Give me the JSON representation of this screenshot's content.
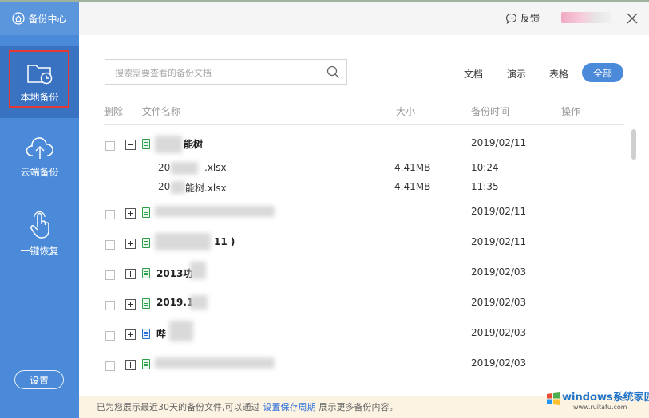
{
  "sidebar": {
    "brand": "备份中心",
    "items": [
      {
        "label": "本地备份",
        "icon": "folder-clock-icon",
        "active": true
      },
      {
        "label": "云端备份",
        "icon": "cloud-upload-icon",
        "active": false
      },
      {
        "label": "一键恢复",
        "icon": "hand-tap-icon",
        "active": false
      }
    ],
    "settings_label": "设置"
  },
  "header": {
    "feedback_label": "反馈",
    "feedback_icon": "chat-bubble-icon",
    "close_icon": "close-icon"
  },
  "search": {
    "placeholder": "搜索需要查看的备份文档",
    "value": ""
  },
  "filters": {
    "doc": "文档",
    "slides": "演示",
    "sheet": "表格",
    "all": "全部",
    "selected": "全部"
  },
  "table": {
    "headers": {
      "delete": "删除",
      "filename": "文件名称",
      "size": "大小",
      "time": "备份时间",
      "action": "操作"
    },
    "rows": [
      {
        "name": "能树",
        "date": "2019/02/11",
        "expanded": true,
        "type": "sheet"
      },
      {
        "name": "",
        "date": "2019/02/11",
        "expanded": false,
        "type": "sheet"
      },
      {
        "name": "11 )",
        "date": "2019/02/11",
        "expanded": false,
        "type": "sheet"
      },
      {
        "name": "2013功",
        "date": "2019/02/03",
        "expanded": false,
        "type": "sheet"
      },
      {
        "name": "2019.1",
        "date": "2019/02/03",
        "expanded": false,
        "type": "sheet"
      },
      {
        "name": "哔",
        "date": "2019/02/03",
        "expanded": false,
        "type": "word"
      },
      {
        "name": "",
        "date": "2019/02/03",
        "expanded": false,
        "type": "sheet"
      }
    ],
    "children": [
      {
        "name": "20",
        "name_suffix": ".xlsx",
        "size": "4.41MB",
        "time": "10:24"
      },
      {
        "name": "20",
        "name_suffix": "能树.xlsx",
        "size": "4.41MB",
        "time": "11:35"
      }
    ]
  },
  "footer": {
    "text_before": "已为您展示最近30天的备份文件,可以通过",
    "link": "设置保存周期",
    "text_after": "展示更多备份内容。"
  },
  "watermark": {
    "title": "windows系统家园",
    "url": "www.ruitafu.com"
  }
}
